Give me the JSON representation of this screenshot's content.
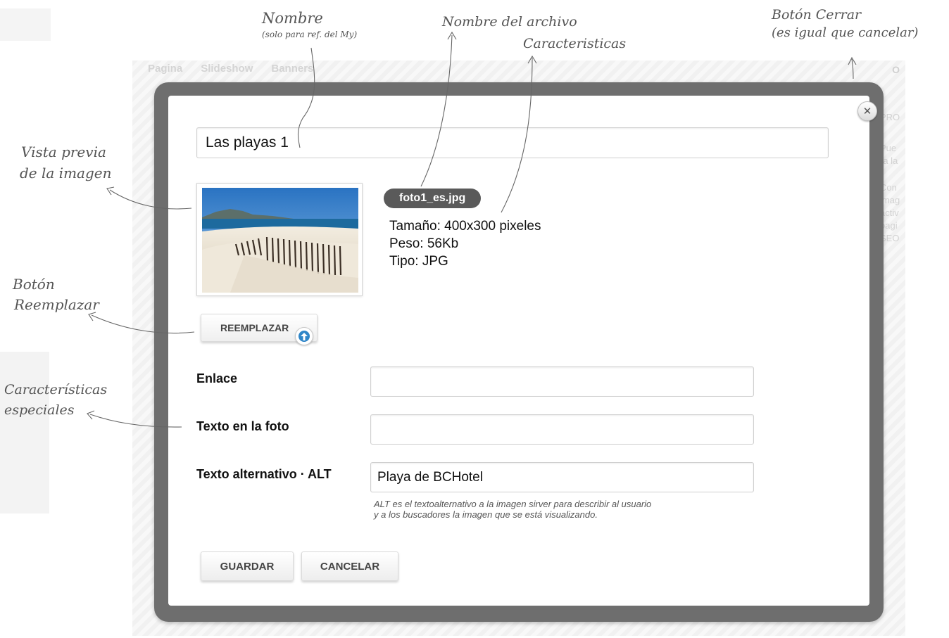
{
  "background": {
    "tabs": [
      "Pagina",
      "Slideshow",
      "Banners"
    ],
    "right_letter": "O",
    "side_fragments": [
      "PRO",
      "Pue\nra la",
      "Con\nimag\nactiv\npagi\nSEO"
    ]
  },
  "modal": {
    "name_value": "Las playas 1",
    "file_name": "foto1_es.jpg",
    "size_text": "Tamaño: 400x300 pixeles",
    "weight_text": "Peso: 56Kb",
    "type_text": "Tipo: JPG",
    "replace_label": "REEMPLAZAR",
    "fields": {
      "link_label": "Enlace",
      "link_value": "",
      "photo_text_label": "Texto en la foto",
      "photo_text_value": "",
      "alt_label": "Texto alternativo · ALT",
      "alt_value": "Playa de BCHotel"
    },
    "help_line1": "ALT es el textoalternativo a la imagen sirver para describir al usuario",
    "help_line2": "y a los buscadores la imagen que se está visualizando.",
    "save_label": "GUARDAR",
    "cancel_label": "CANCELAR",
    "close_icon": "close-icon",
    "upload_icon": "upload-arrow-icon"
  },
  "annotations": {
    "nombre_title": "Nombre",
    "nombre_sub": "(solo para ref. del My)",
    "archivo": "Nombre del archivo",
    "caracteristicas": "Caracteristicas",
    "cerrar_line1": "Botón Cerrar",
    "cerrar_line2": "(es igual que cancelar)",
    "vista_line1": "Vista previa",
    "vista_line2": "de la imagen",
    "reemplazar_line1": "Botón",
    "reemplazar_line2": "Reemplazar",
    "especiales_line1": "Características",
    "especiales_line2": "especiales"
  },
  "colors": {
    "modal_frame": "#6e6e6e",
    "file_pill": "#5a5a5a",
    "upload_accent": "#2f86c8"
  }
}
